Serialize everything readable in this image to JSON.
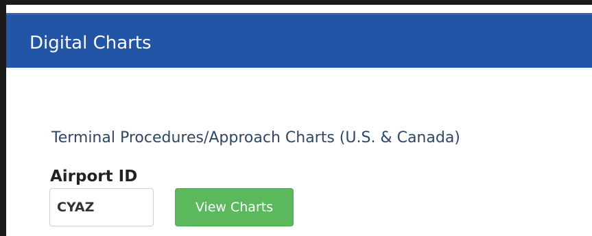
{
  "panel": {
    "title": "Digital Charts"
  },
  "section": {
    "title": "Terminal Procedures/Approach Charts (U.S. & Canada)"
  },
  "airport_field": {
    "label": "Airport ID",
    "value": "CYAZ",
    "placeholder": ""
  },
  "actions": {
    "view_charts_label": "View Charts"
  },
  "colors": {
    "header_bg": "#2255a5",
    "button_bg": "#5cb85c",
    "section_title": "#2f4763"
  }
}
